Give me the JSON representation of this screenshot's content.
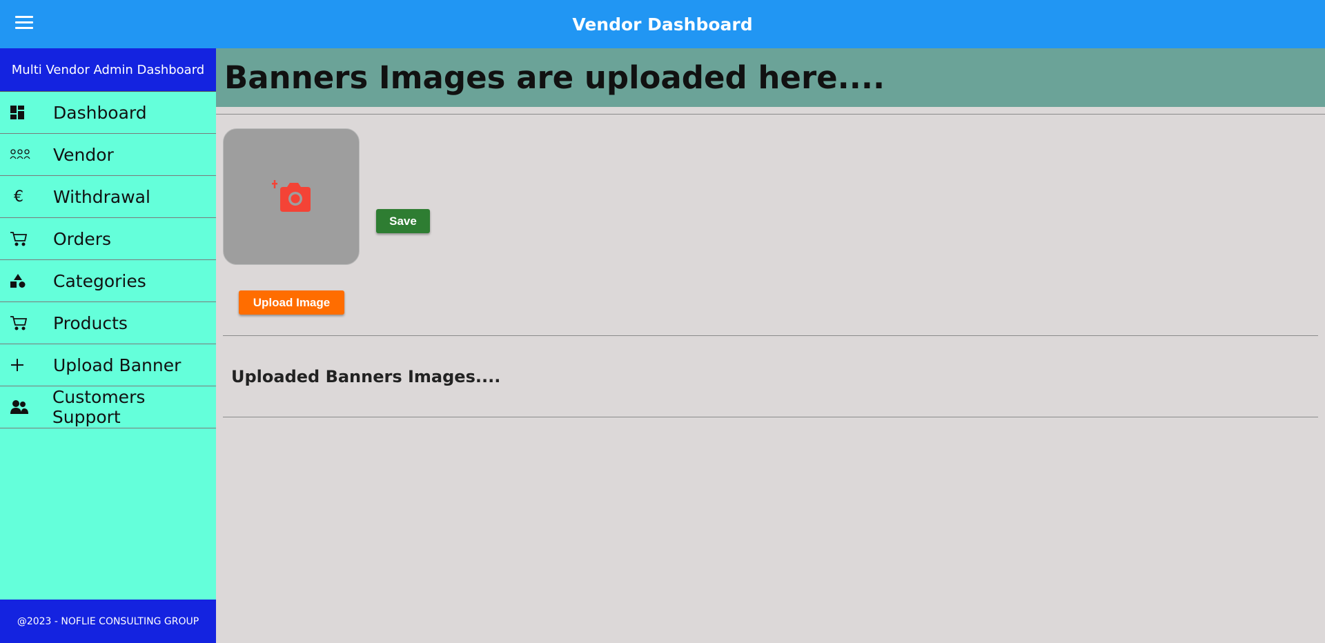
{
  "header": {
    "title": "Vendor Dashboard",
    "menu_icon": "menu-icon",
    "color": "#2196F3"
  },
  "sidebar": {
    "title": "Multi Vendor Admin Dashboard",
    "footer": "@2023 - NOFLIE CONSULTING GROUP",
    "items": [
      {
        "label": "Dashboard",
        "icon": "dashboard-icon"
      },
      {
        "label": "Vendor",
        "icon": "people-icon"
      },
      {
        "label": "Withdrawal",
        "icon": "euro-icon"
      },
      {
        "label": "Orders",
        "icon": "cart-icon"
      },
      {
        "label": "Categories",
        "icon": "shapes-icon"
      },
      {
        "label": "Products",
        "icon": "cart-icon"
      },
      {
        "label": "Upload Banner",
        "icon": "plus-icon"
      },
      {
        "label": "Customers Support",
        "icon": "user-group-icon"
      }
    ],
    "colors": {
      "background": "#64FFDA",
      "header": "#1423E0"
    }
  },
  "main": {
    "heading": "Banners Images are uploaded here....",
    "upload_placeholder_icon": "add-photo-icon",
    "save_label": "Save",
    "upload_label": "Upload Image",
    "uploaded_title": "Uploaded Banners Images....",
    "colors": {
      "heading_bg": "#6BA398",
      "save": "#2E7D32",
      "upload": "#FF6D00",
      "camera": "#F44336"
    }
  }
}
